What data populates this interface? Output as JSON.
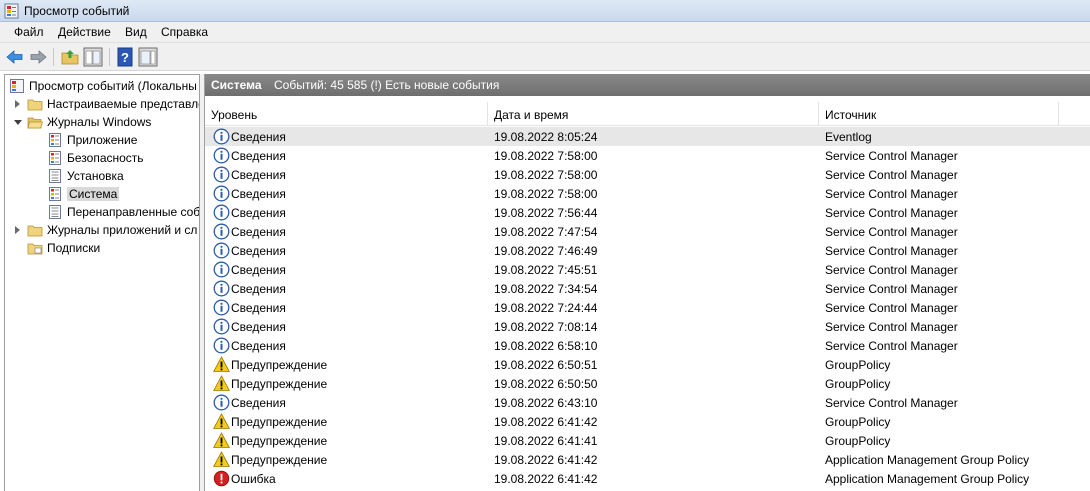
{
  "window": {
    "title": "Просмотр событий"
  },
  "menu": [
    "Файл",
    "Действие",
    "Вид",
    "Справка"
  ],
  "tree": {
    "root": "Просмотр событий (Локальны",
    "custom_views": "Настраиваемые представле",
    "windows_logs": "Журналы Windows",
    "application": "Приложение",
    "security": "Безопасность",
    "setup": "Установка",
    "system": "Система",
    "forwarded": "Перенаправленные соб",
    "app_logs": "Журналы приложений и сл",
    "subscriptions": "Подписки"
  },
  "panel": {
    "title": "Система",
    "info": "Событий: 45 585 (!) Есть новые события"
  },
  "columns": {
    "level": "Уровень",
    "datetime": "Дата и время",
    "source": "Источник"
  },
  "events": [
    {
      "type": "info",
      "level": "Сведения",
      "date": "19.08.2022 8:05:24",
      "source": "Eventlog"
    },
    {
      "type": "info",
      "level": "Сведения",
      "date": "19.08.2022 7:58:00",
      "source": "Service Control Manager"
    },
    {
      "type": "info",
      "level": "Сведения",
      "date": "19.08.2022 7:58:00",
      "source": "Service Control Manager"
    },
    {
      "type": "info",
      "level": "Сведения",
      "date": "19.08.2022 7:58:00",
      "source": "Service Control Manager"
    },
    {
      "type": "info",
      "level": "Сведения",
      "date": "19.08.2022 7:56:44",
      "source": "Service Control Manager"
    },
    {
      "type": "info",
      "level": "Сведения",
      "date": "19.08.2022 7:47:54",
      "source": "Service Control Manager"
    },
    {
      "type": "info",
      "level": "Сведения",
      "date": "19.08.2022 7:46:49",
      "source": "Service Control Manager"
    },
    {
      "type": "info",
      "level": "Сведения",
      "date": "19.08.2022 7:45:51",
      "source": "Service Control Manager"
    },
    {
      "type": "info",
      "level": "Сведения",
      "date": "19.08.2022 7:34:54",
      "source": "Service Control Manager"
    },
    {
      "type": "info",
      "level": "Сведения",
      "date": "19.08.2022 7:24:44",
      "source": "Service Control Manager"
    },
    {
      "type": "info",
      "level": "Сведения",
      "date": "19.08.2022 7:08:14",
      "source": "Service Control Manager"
    },
    {
      "type": "info",
      "level": "Сведения",
      "date": "19.08.2022 6:58:10",
      "source": "Service Control Manager"
    },
    {
      "type": "warning",
      "level": "Предупреждение",
      "date": "19.08.2022 6:50:51",
      "source": "GroupPolicy"
    },
    {
      "type": "warning",
      "level": "Предупреждение",
      "date": "19.08.2022 6:50:50",
      "source": "GroupPolicy"
    },
    {
      "type": "info",
      "level": "Сведения",
      "date": "19.08.2022 6:43:10",
      "source": "Service Control Manager"
    },
    {
      "type": "warning",
      "level": "Предупреждение",
      "date": "19.08.2022 6:41:42",
      "source": "GroupPolicy"
    },
    {
      "type": "warning",
      "level": "Предупреждение",
      "date": "19.08.2022 6:41:41",
      "source": "GroupPolicy"
    },
    {
      "type": "warning",
      "level": "Предупреждение",
      "date": "19.08.2022 6:41:42",
      "source": "Application Management Group Policy"
    },
    {
      "type": "error",
      "level": "Ошибка",
      "date": "19.08.2022 6:41:42",
      "source": "Application Management Group Policy"
    }
  ]
}
